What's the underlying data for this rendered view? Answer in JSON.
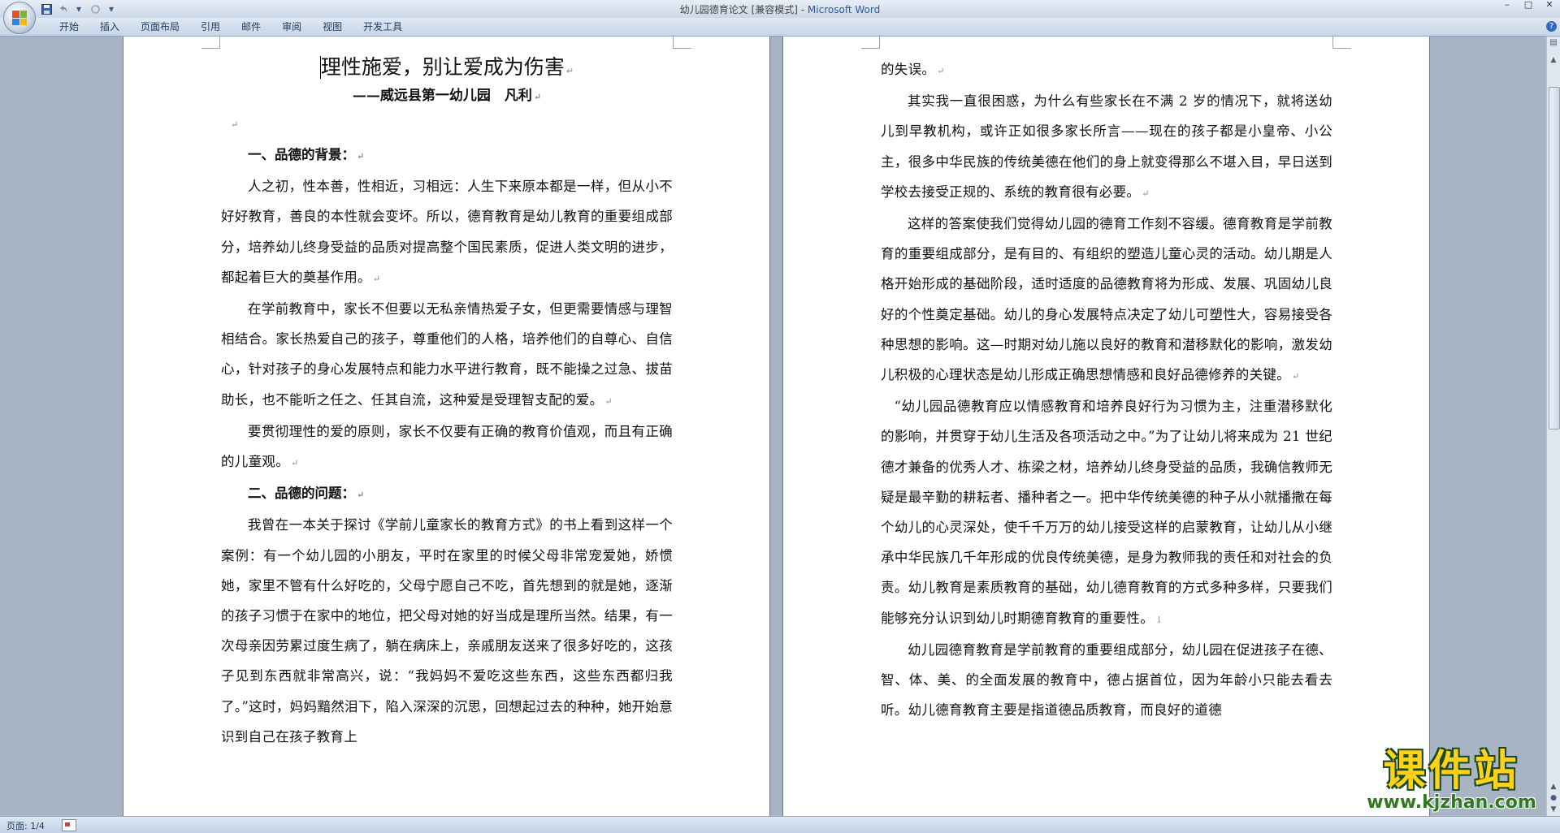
{
  "window": {
    "doc_title": "幼儿园德育论文 [兼容模式] - ",
    "app_name": "Microsoft Word",
    "minimize": "–",
    "maximize": "□",
    "close": "✕"
  },
  "qat": {
    "undo_arrow": "▾",
    "customize_arrow": "▾"
  },
  "ribbon": {
    "tabs": [
      "开始",
      "插入",
      "页面布局",
      "引用",
      "邮件",
      "审阅",
      "视图",
      "开发工具"
    ],
    "help": "?"
  },
  "status": {
    "page": "页面: 1/4"
  },
  "watermark": {
    "main": "课件站",
    "url": "www.kjzhan.com"
  },
  "marks": {
    "para": "↵",
    "manual_break": "↓"
  },
  "page1": {
    "title": "理性施爱，别让爱成为伤害",
    "subtitle": "——威远县第一幼儿园　凡利",
    "h1": "一、品德的背景：",
    "p1": "人之初，性本善，性相近，习相远：人生下来原本都是一样，但从小不好好教育，善良的本性就会变坏。所以，德育教育是幼儿教育的重要组成部分，培养幼儿终身受益的品质对提高整个国民素质，促进人类文明的进步，都起着巨大的奠基作用。",
    "p2": "在学前教育中，家长不但要以无私亲情热爱子女，但更需要情感与理智相结合。家长热爱自己的孩子，尊重他们的人格，培养他们的自尊心、自信心，针对孩子的身心发展特点和能力水平进行教育，既不能操之过急、拔苗助长，也不能听之任之、任其自流，这种爱是受理智支配的爱。",
    "p3": "要贯彻理性的爱的原则，家长不仅要有正确的教育价值观，而且有正确的儿童观。",
    "h2": "二、品德的问题：",
    "p4": "我曾在一本关于探讨《学前儿童家长的教育方式》的书上看到这样一个案例：有一个幼儿园的小朋友，平时在家里的时候父母非常宠爱她，娇惯她，家里不管有什么好吃的，父母宁愿自己不吃，首先想到的就是她，逐渐的孩子习惯于在家中的地位，把父母对她的好当成是理所当然。结果，有一次母亲因劳累过度生病了，躺在病床上，亲戚朋友送来了很多好吃的，这孩子见到东西就非常高兴，说：“我妈妈不爱吃这些东西，这些东西都归我了。”这时，妈妈黯然泪下，陷入深深的沉思，回想起过去的种种，她开始意识到自己在孩子教育上"
  },
  "page2": {
    "p0": "的失误。",
    "p1": "其实我一直很困惑，为什么有些家长在不满 2 岁的情况下，就将送幼儿到早教机构，或许正如很多家长所言——现在的孩子都是小皇帝、小公主，很多中华民族的传统美德在他们的身上就变得那么不堪入目，早日送到学校去接受正规的、系统的教育很有必要。",
    "p2": "这样的答案使我们觉得幼儿园的德育工作刻不容缓。德育教育是学前教育的重要组成部分，是有目的、有组织的塑造儿童心灵的活动。幼儿期是人格开始形成的基础阶段，适时适度的品德教育将为形成、发展、巩固幼儿良好的个性奠定基础。幼儿的身心发展特点决定了幼儿可塑性大，容易接受各种思想的影响。这—时期对幼儿施以良好的教育和潜移默化的影响，激发幼儿积极的心理状态是幼儿形成正确思想情感和良好品德修养的关键。",
    "p3": "“幼儿园品德教育应以情感教育和培养良好行为习惯为主，注重潜移默化的影响，并贯穿于幼儿生活及各项活动之中。”为了让幼儿将来成为 21 世纪德才兼备的优秀人才、栋梁之材，培养幼儿终身受益的品质，我确信教师无疑是最辛勤的耕耘者、播种者之一。把中华传统美德的种子从小就播撒在每个幼儿的心灵深处，使千千万万的幼儿接受这样的启蒙教育，让幼儿从小继承中华民族几千年形成的优良传统美德，是身为教师我的责任和对社会的负责。幼儿教育是素质教育的基础，幼儿德育教育的方式多种多样，只要我们能够充分认识到幼儿时期德育教育的重要性。",
    "p4": "幼儿园德育教育是学前教育的重要组成部分，幼儿园在促进孩子在德、智、体、美、的全面发展的教育中，德占据首位，因为年龄小只能去看去听。幼儿德育教育主要是指道德品质教育，而良好的道德"
  }
}
